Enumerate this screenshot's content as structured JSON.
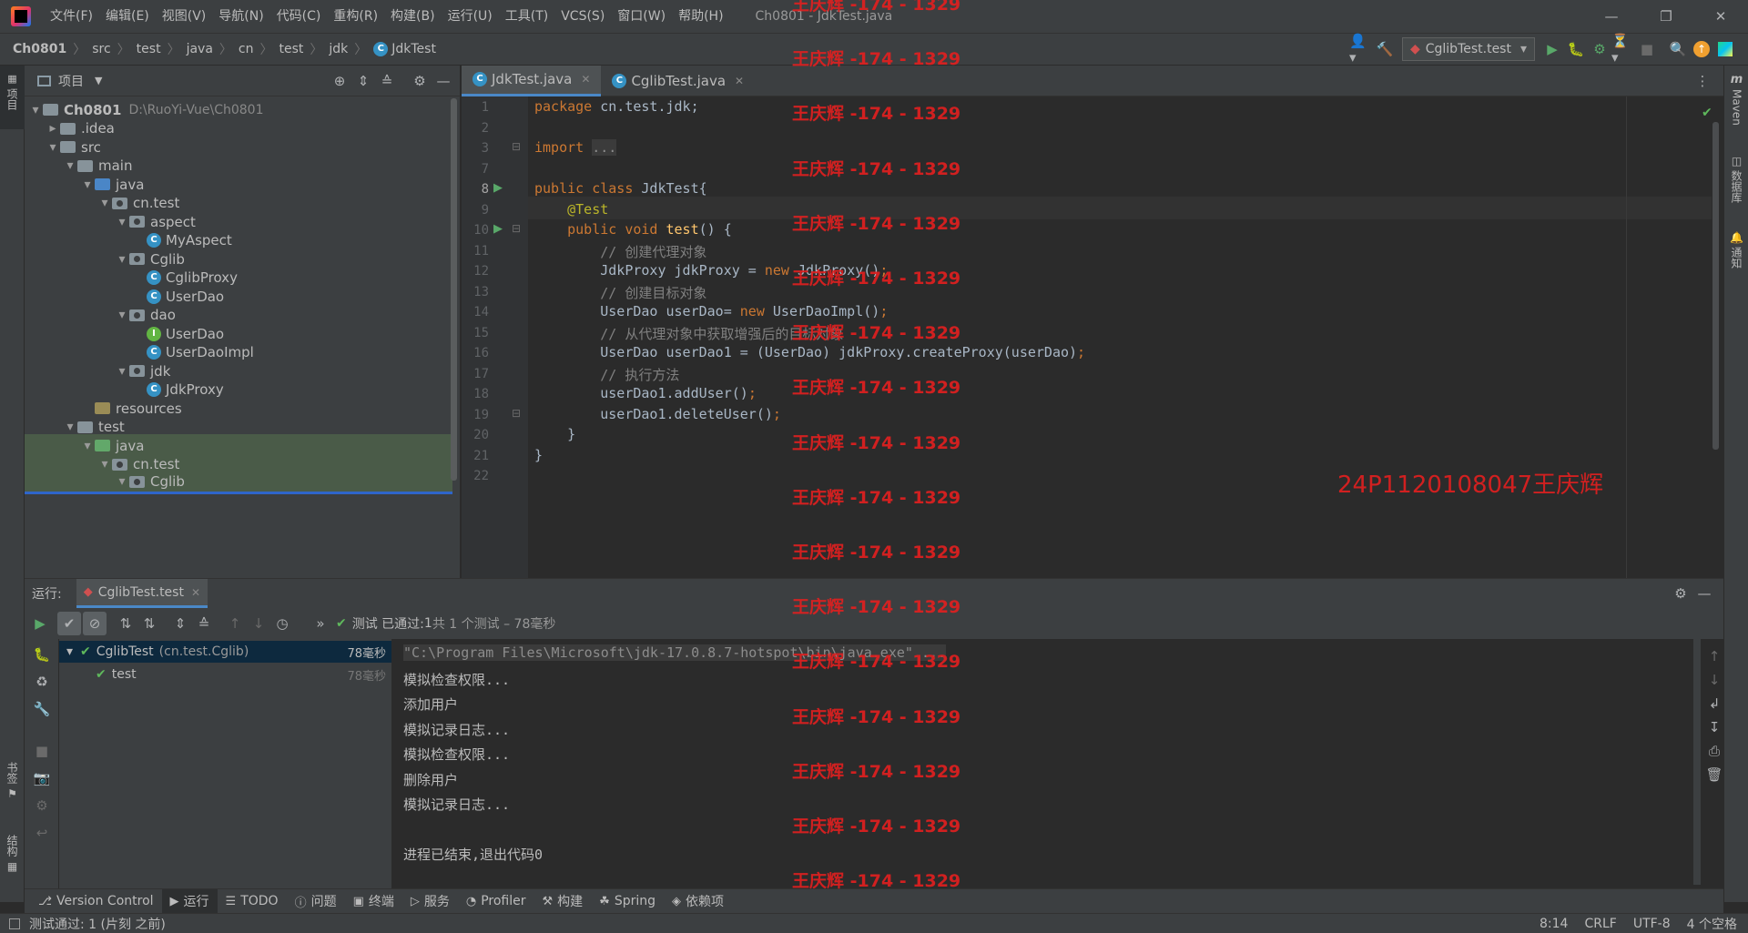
{
  "menubar": {
    "items": [
      "文件(F)",
      "编辑(E)",
      "视图(V)",
      "导航(N)",
      "代码(C)",
      "重构(R)",
      "构建(B)",
      "运行(U)",
      "工具(T)",
      "VCS(S)",
      "窗口(W)",
      "帮助(H)"
    ],
    "window_title": "Ch0801 - JdkTest.java"
  },
  "navbar": {
    "breadcrumbs": [
      "Ch0801",
      "src",
      "test",
      "java",
      "cn",
      "test",
      "jdk",
      "JdkTest"
    ],
    "run_config": "CglibTest.test"
  },
  "left_strip": {
    "project_label": "项目",
    "bookmarks_label": "书签",
    "structure_label": "结构"
  },
  "right_strip": {
    "maven_label": "Maven",
    "database_label": "数据库",
    "notifications_label": "通知"
  },
  "project": {
    "title": "项目",
    "tree": [
      {
        "label": "Ch0801",
        "extra": "D:\\RuoYi-Vue\\Ch0801",
        "depth": 0,
        "type": "module",
        "open": true
      },
      {
        "label": ".idea",
        "depth": 1,
        "type": "folder",
        "open": false
      },
      {
        "label": "src",
        "depth": 1,
        "type": "folder",
        "open": true
      },
      {
        "label": "main",
        "depth": 2,
        "type": "folder",
        "open": true
      },
      {
        "label": "java",
        "depth": 3,
        "type": "srcfolder",
        "open": true
      },
      {
        "label": "cn.test",
        "depth": 4,
        "type": "package",
        "open": true
      },
      {
        "label": "aspect",
        "depth": 5,
        "type": "package",
        "open": true
      },
      {
        "label": "MyAspect",
        "depth": 6,
        "type": "class"
      },
      {
        "label": "Cglib",
        "depth": 5,
        "type": "package",
        "open": true
      },
      {
        "label": "CglibProxy",
        "depth": 6,
        "type": "class"
      },
      {
        "label": "UserDao",
        "depth": 6,
        "type": "class"
      },
      {
        "label": "dao",
        "depth": 5,
        "type": "package",
        "open": true
      },
      {
        "label": "UserDao",
        "depth": 6,
        "type": "interface"
      },
      {
        "label": "UserDaoImpl",
        "depth": 6,
        "type": "class"
      },
      {
        "label": "jdk",
        "depth": 5,
        "type": "package",
        "open": true
      },
      {
        "label": "JdkProxy",
        "depth": 6,
        "type": "class"
      },
      {
        "label": "resources",
        "depth": 3,
        "type": "resfolder"
      },
      {
        "label": "test",
        "depth": 2,
        "type": "folder",
        "open": true
      },
      {
        "label": "java",
        "depth": 3,
        "type": "testfolder",
        "open": true
      },
      {
        "label": "cn.test",
        "depth": 4,
        "type": "package",
        "open": true
      },
      {
        "label": "Cglib",
        "depth": 5,
        "type": "package",
        "open": true
      }
    ]
  },
  "editor": {
    "tabs": [
      {
        "label": "JdkTest.java",
        "active": true
      },
      {
        "label": "CglibTest.java",
        "active": false
      }
    ],
    "lines": [
      {
        "n": "1",
        "html": "<span class='kw'>package</span> cn.test.jdk;"
      },
      {
        "n": "2",
        "html": ""
      },
      {
        "n": "3",
        "html": "<span class='kw'>import</span> <span style='background:#3b3b3b;color:#8c8c8c'>...</span>"
      },
      {
        "n": "7",
        "html": ""
      },
      {
        "n": "8",
        "html": "<span class='kw'>public class</span> JdkTest{"
      },
      {
        "n": "9",
        "html": "    <span class='an'>@Test</span>"
      },
      {
        "n": "10",
        "html": "    <span class='kw'>public void</span> <span class='fn'>test</span>() {"
      },
      {
        "n": "11",
        "html": "        <span class='cm'>// 创建代理对象</span>"
      },
      {
        "n": "12",
        "html": "        JdkProxy jdkProxy = <span class='kw'>new</span> JdkProxy()<span class='kw'>;</span>"
      },
      {
        "n": "13",
        "html": "        <span class='cm'>// 创建目标对象</span>"
      },
      {
        "n": "14",
        "html": "        UserDao userDao= <span class='kw'>new</span> UserDaoImpl()<span class='kw'>;</span>"
      },
      {
        "n": "15",
        "html": "        <span class='cm'>// 从代理对象中获取增强后的目标对象</span>"
      },
      {
        "n": "16",
        "html": "        UserDao userDao1 = (UserDao) jdkProxy.createProxy(userDao)<span class='kw'>;</span>"
      },
      {
        "n": "17",
        "html": "        <span class='cm'>// 执行方法</span>"
      },
      {
        "n": "18",
        "html": "        userDao1.addUser()<span class='kw'>;</span>"
      },
      {
        "n": "19",
        "html": "        userDao1.deleteUser()<span class='kw'>;</span>"
      },
      {
        "n": "20",
        "html": "    }"
      },
      {
        "n": "21",
        "html": "}"
      },
      {
        "n": "22",
        "html": ""
      }
    ]
  },
  "watermarks": {
    "repeat_text": "王庆辉 -174 - 1329",
    "student_id": "24P1120108047王庆辉"
  },
  "run": {
    "label": "运行:",
    "tab": "CglibTest.test",
    "status_prefix": "测试 已通过:",
    "status_count": "1",
    "status_suffix": "共 1 个测试 – 78毫秒",
    "tree": [
      {
        "label": "CglibTest",
        "extra": "(cn.test.Cglib)",
        "time": "78毫秒"
      },
      {
        "label": "test",
        "extra": "",
        "time": "78毫秒"
      }
    ],
    "console": [
      "\"C:\\Program Files\\Microsoft\\jdk-17.0.8.7-hotspot\\bin\\java.exe\" ...",
      "模拟检查权限...",
      "添加用户",
      "模拟记录日志...",
      "模拟检查权限...",
      "删除用户",
      "模拟记录日志...",
      "",
      "进程已结束,退出代码0"
    ]
  },
  "bottom_tabs": [
    "Version Control",
    "运行",
    "TODO",
    "问题",
    "终端",
    "服务",
    "Profiler",
    "构建",
    "Spring",
    "依赖项"
  ],
  "statusbar": {
    "message": "测试通过: 1 (片刻 之前)",
    "position": "8:14",
    "line_sep": "CRLF",
    "encoding": "UTF-8",
    "indent": "4 个空格"
  }
}
